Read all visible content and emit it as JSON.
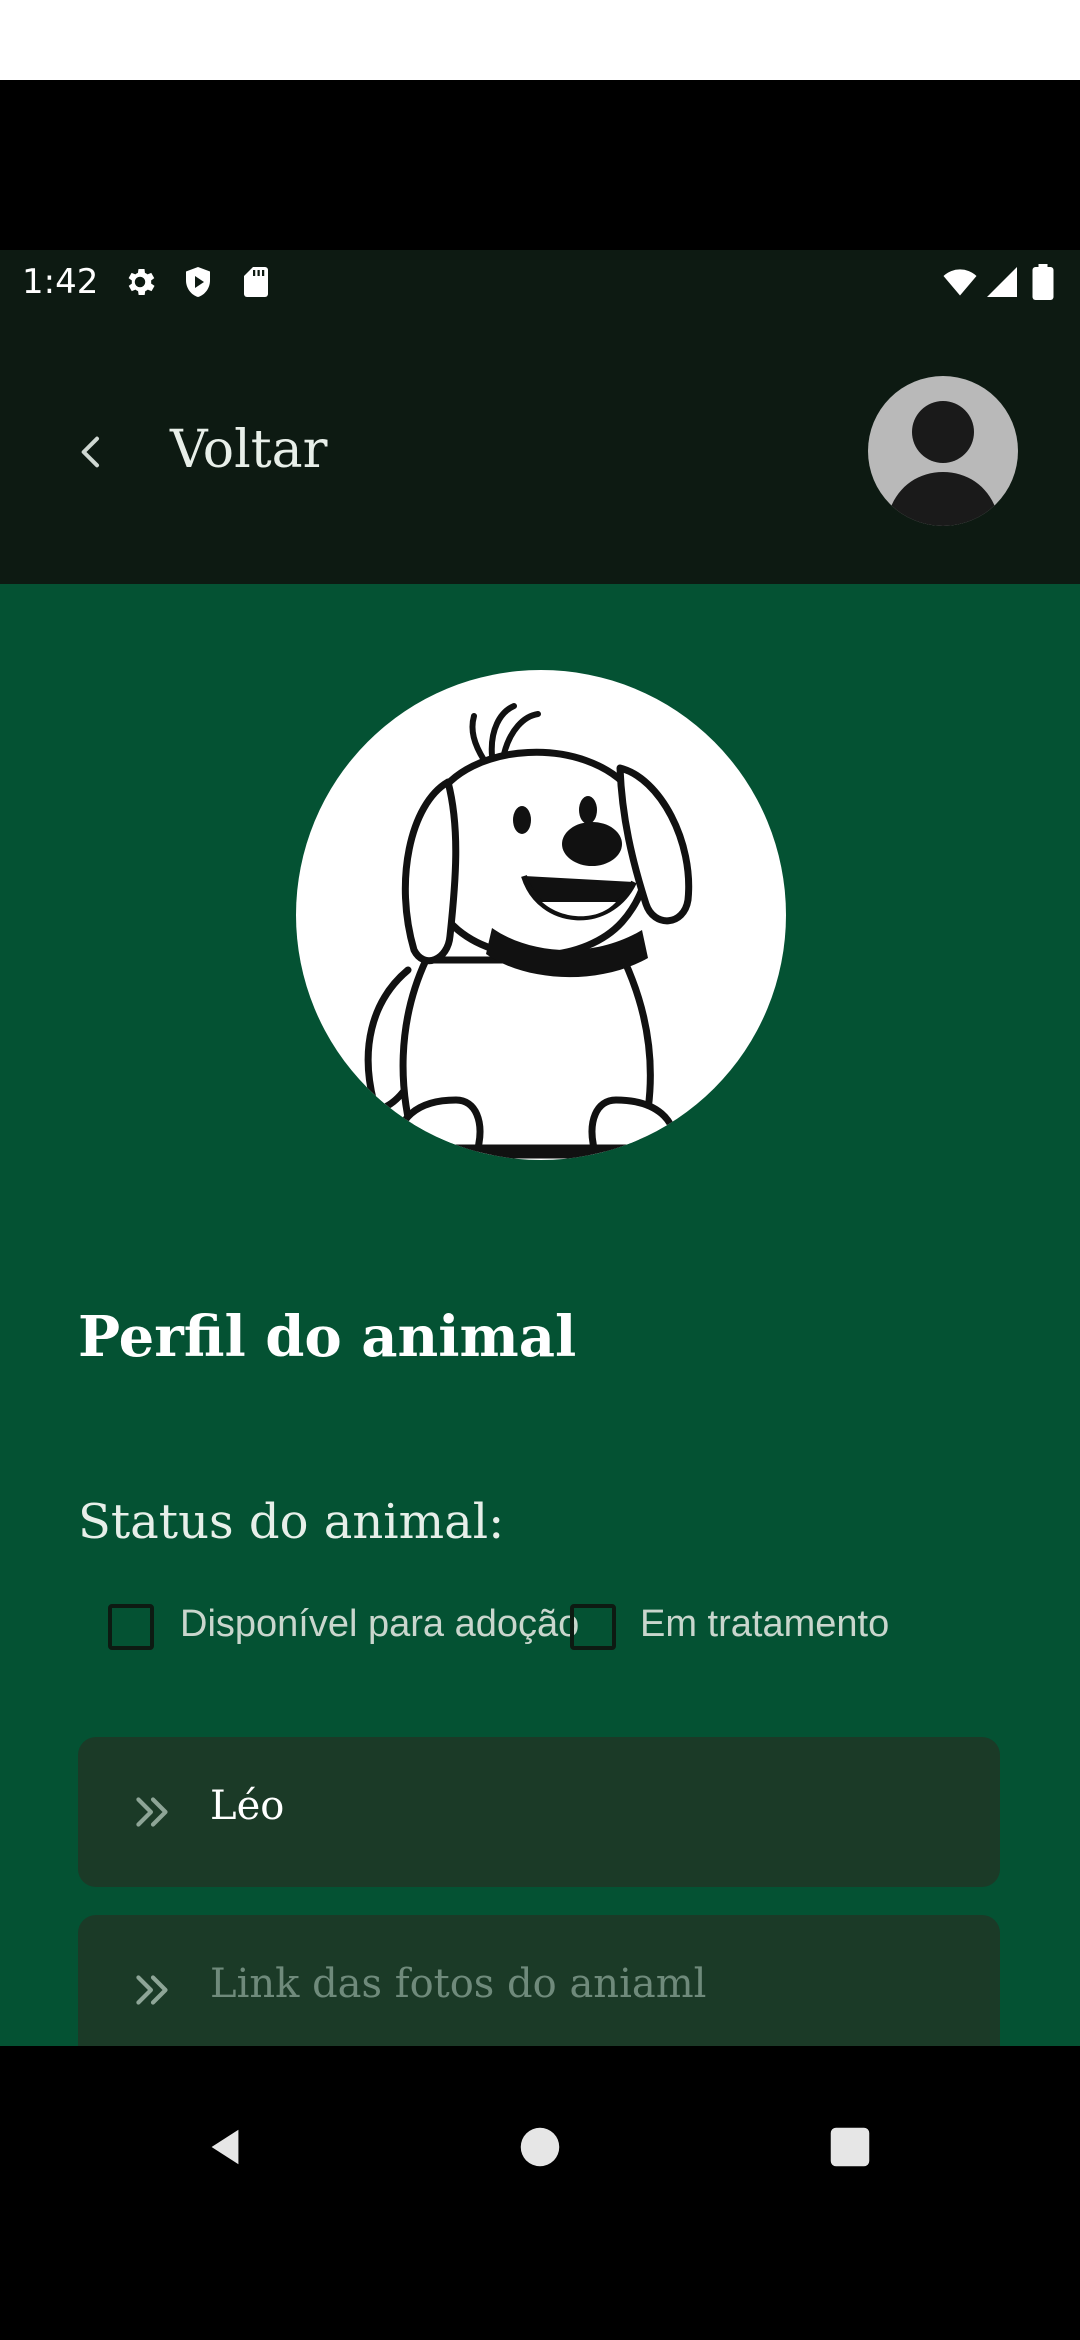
{
  "status_bar": {
    "time": "1:42",
    "left_icons": [
      "settings-icon",
      "shield-play-icon",
      "sd-card-icon"
    ],
    "right_icons": [
      "wifi-icon",
      "signal-icon",
      "battery-icon"
    ]
  },
  "app_bar": {
    "back_label": "Voltar",
    "back_icon": "chevron-left-icon",
    "avatar_icon": "user-avatar-icon"
  },
  "profile": {
    "photo": "dog-illustration",
    "title": "Perfil do animal",
    "status_label": "Status do animal:",
    "options": [
      {
        "label": "Disponível para adoção",
        "checked": false
      },
      {
        "label": "Em tratamento",
        "checked": false
      }
    ],
    "fields": [
      {
        "value": "Léo",
        "placeholder": ""
      },
      {
        "value": "",
        "placeholder": "Link das fotos do aniaml"
      }
    ]
  },
  "nav_bar": {
    "back": "nav-back-icon",
    "home": "nav-home-icon",
    "recents": "nav-recents-icon"
  },
  "colors": {
    "app_bar": "#0d1a12",
    "content_bg": "#045233",
    "field_bg": "#1b3a27",
    "text": "#ffffff",
    "muted_text": "#6f8a7b"
  }
}
